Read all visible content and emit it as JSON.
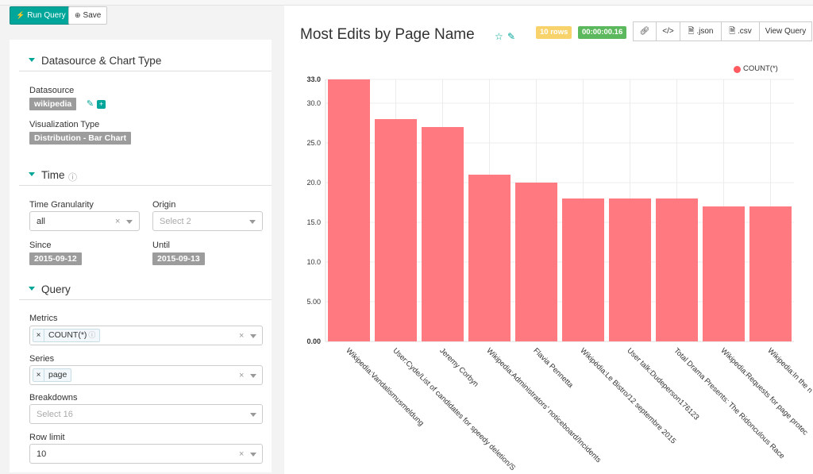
{
  "toolbar": {
    "run_label": "Run Query",
    "save_label": "Save"
  },
  "sections": {
    "datasource": "Datasource & Chart Type",
    "time": "Time",
    "query": "Query"
  },
  "datasource": {
    "label": "Datasource",
    "value": "wikipedia",
    "viz_label": "Visualization Type",
    "viz_value": "Distribution - Bar Chart"
  },
  "time": {
    "granularity_label": "Time Granularity",
    "granularity_value": "all",
    "origin_label": "Origin",
    "origin_placeholder": "Select 2",
    "since_label": "Since",
    "since_value": "2015-09-12",
    "until_label": "Until",
    "until_value": "2015-09-13"
  },
  "query": {
    "metrics_label": "Metrics",
    "metric_value": "COUNT(*)",
    "series_label": "Series",
    "series_value": "page",
    "breakdowns_label": "Breakdowns",
    "breakdowns_placeholder": "Select 16",
    "rowlimit_label": "Row limit",
    "rowlimit_value": "10"
  },
  "header": {
    "title": "Most Edits by Page Name",
    "rows_badge": "10 rows",
    "time_badge": "00:00:00.16",
    "json_label": ".json",
    "csv_label": ".csv",
    "view_query_label": "View Query"
  },
  "colors": {
    "accent": "#00a699",
    "bar": "#ff7a80",
    "rows_badge": "#f8d36b",
    "time_badge": "#5cb85c"
  },
  "chart_data": {
    "type": "bar",
    "categories": [
      "Wikipedia:Vandalismusmeldung",
      "User:Cyde/List of candidates for speedy deletion/S",
      "Jeremy Corbyn",
      "Wikipedia:Administrators' noticeboard/Incidents",
      "Flavia Pennetta",
      "Wikipédia:Le Bistro/12 septembre 2015",
      "User talk:Dudeperson176123",
      "Total Drama Presents: The Ridonculous Race",
      "Wikipedia:Requests for page protec",
      "Wikipedia:In the n"
    ],
    "series": [
      {
        "name": "COUNT(*)",
        "values": [
          33,
          28,
          27,
          21,
          20,
          18,
          18,
          18,
          17,
          17
        ]
      }
    ],
    "yticks": [
      "0.00",
      "5.00",
      "10.0",
      "15.0",
      "20.0",
      "25.0",
      "30.0",
      "33.0"
    ],
    "ylim": [
      0,
      33
    ],
    "grid": true,
    "legend": "top-right"
  }
}
